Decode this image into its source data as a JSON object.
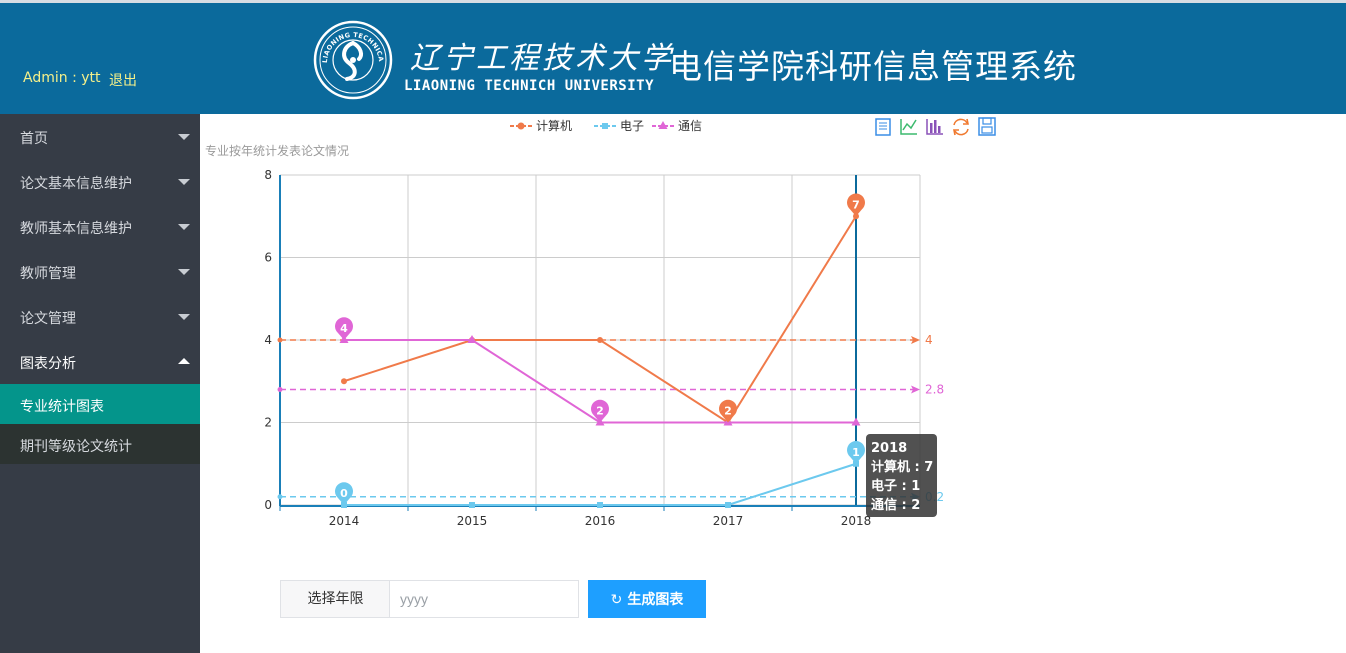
{
  "header": {
    "admin_label": "Admin : ytt",
    "logout_label": "退出",
    "university_cn": "辽宁工程技术大学",
    "university_en": "LIAONING TECHNICH UNIVERSITY",
    "seal_text": "LIAONING TECHNICAL UNIVERSITY",
    "system_title": "电信学院科研信息管理系统",
    "bg_color": "#0b6a9c"
  },
  "sidebar": {
    "items": [
      {
        "label": "首页",
        "expanded": false
      },
      {
        "label": "论文基本信息维护",
        "expanded": false
      },
      {
        "label": "教师基本信息维护",
        "expanded": false
      },
      {
        "label": "教师管理",
        "expanded": false
      },
      {
        "label": "论文管理",
        "expanded": false
      },
      {
        "label": "图表分析",
        "expanded": true
      }
    ],
    "sub_items": [
      {
        "label": "专业统计图表",
        "active": true
      },
      {
        "label": "期刊等级论文统计",
        "active": false
      }
    ]
  },
  "toolbox": {
    "icons": [
      "data-view-icon",
      "line-chart-icon",
      "bar-chart-icon",
      "restore-icon",
      "save-image-icon"
    ]
  },
  "chart_data": {
    "type": "line",
    "title": "专业按年统计发表论文情况",
    "categories": [
      "2014",
      "2015",
      "2016",
      "2017",
      "2018"
    ],
    "ylim": [
      0,
      8
    ],
    "yticks": [
      "0",
      "2",
      "4",
      "6",
      "8"
    ],
    "grid": true,
    "legend_position": "top-center",
    "series": [
      {
        "name": "计算机",
        "color": "#f07a4a",
        "values": [
          3,
          4,
          4,
          2,
          7
        ],
        "mark_points": [
          {
            "label": "7",
            "index": 4
          },
          {
            "label": "2",
            "index": 3
          }
        ],
        "mark_line": {
          "value": 4,
          "label": "4"
        }
      },
      {
        "name": "电子",
        "color": "#6cc9ee",
        "values": [
          0,
          0,
          0,
          0,
          1
        ],
        "mark_points": [
          {
            "label": "1",
            "index": 4
          },
          {
            "label": "0",
            "index": 0
          }
        ],
        "mark_line": {
          "value": 0.2,
          "label": "0.2"
        }
      },
      {
        "name": "通信",
        "color": "#e066d6",
        "values": [
          4,
          4,
          2,
          2,
          2
        ],
        "mark_points": [
          {
            "label": "4",
            "index": 0
          },
          {
            "label": "2",
            "index": 2
          }
        ],
        "mark_line": {
          "value": 2.8,
          "label": "2.8"
        }
      }
    ],
    "tooltip": {
      "title": "2018",
      "lines": [
        "计算机 : 7",
        "电子 : 1",
        "通信 : 2"
      ],
      "index": 4
    }
  },
  "controls": {
    "year_label": "选择年限",
    "year_placeholder": "yyyy",
    "generate_label": "生成图表"
  }
}
